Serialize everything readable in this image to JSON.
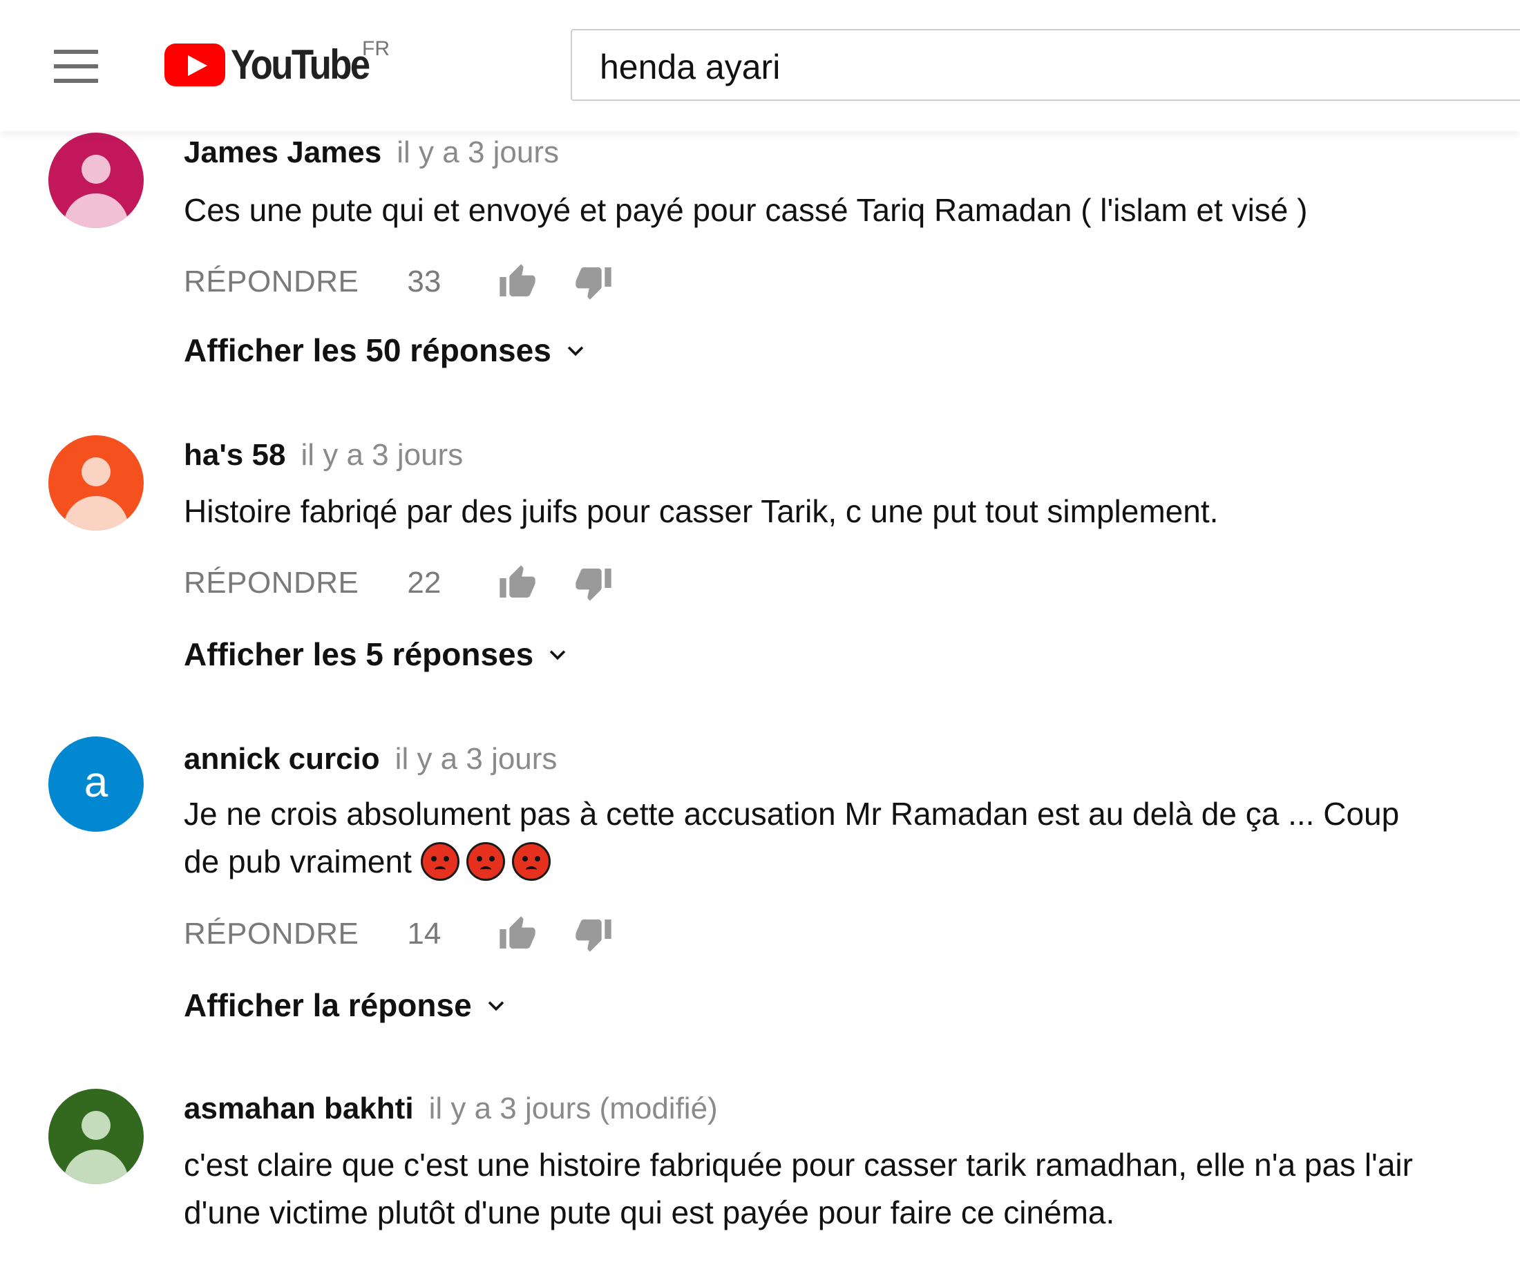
{
  "header": {
    "logo_text": "YouTube",
    "region": "FR",
    "search_value": "henda ayari"
  },
  "comments": [
    {
      "author": "James James",
      "time": "il y a 3 jours",
      "text": "Ces une pute qui et envoyé et payé pour cassé Tariq Ramadan (  l'islam et visé  )",
      "reply_label": "RÉPONDRE",
      "likes": "33",
      "replies_label": "Afficher les 50 réponses",
      "avatar_color": "#c2185b",
      "avatar_fg": "#f2c0d4"
    },
    {
      "author": "ha's 58",
      "time": "il y a 3 jours",
      "text": "Histoire fabriqé par des juifs pour casser Tarik, c une put tout simplement.",
      "reply_label": "RÉPONDRE",
      "likes": "22",
      "replies_label": "Afficher les 5 réponses",
      "avatar_color": "#f4511e",
      "avatar_fg": "#fbd3c3"
    },
    {
      "author": "annick curcio",
      "time": "il y a 3 jours",
      "text_line1": "Je ne crois absolument pas à cette accusation Mr Ramadan est au delà de ça ...   Coup",
      "text_line2": "de pub vraiment",
      "emojis": [
        "angry-face",
        "angry-face",
        "angry-face"
      ],
      "reply_label": "RÉPONDRE",
      "likes": "14",
      "replies_label": "Afficher la réponse",
      "avatar_color": "#0288d1",
      "avatar_letter": "a"
    },
    {
      "author": "asmahan bakhti",
      "time": "il y a 3 jours (modifié)",
      "text_line1": "c'est claire que c'est une histoire fabriquée pour casser tarik ramadhan, elle n'a pas l'air",
      "text_line2": "d'une victime plutôt d'une pute qui est payée pour faire ce cinéma.",
      "avatar_color": "#33691e",
      "avatar_fg": "#c5dcbc"
    }
  ]
}
